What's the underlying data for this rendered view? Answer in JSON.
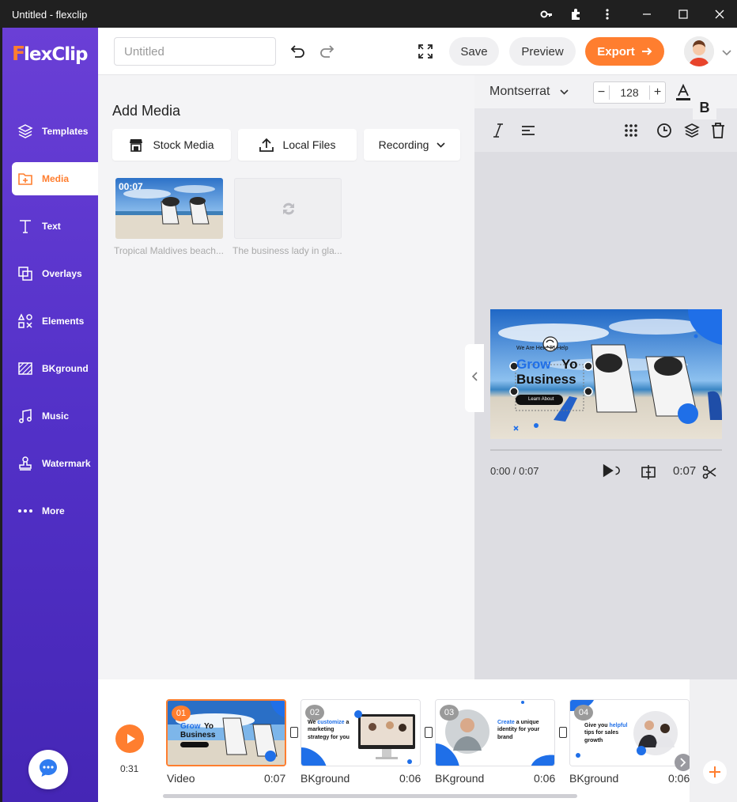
{
  "window": {
    "title": "Untitled - flexclip"
  },
  "logo": {
    "text": "FlexClip"
  },
  "sidebar": {
    "items": [
      {
        "label": "Templates",
        "icon": "layers-icon"
      },
      {
        "label": "Media",
        "icon": "media-folder-icon"
      },
      {
        "label": "Text",
        "icon": "text-icon"
      },
      {
        "label": "Overlays",
        "icon": "overlays-icon"
      },
      {
        "label": "Elements",
        "icon": "elements-icon"
      },
      {
        "label": "BKground",
        "icon": "background-icon"
      },
      {
        "label": "Music",
        "icon": "music-icon"
      },
      {
        "label": "Watermark",
        "icon": "watermark-icon"
      },
      {
        "label": "More",
        "icon": "more-icon"
      }
    ],
    "active": "Media"
  },
  "header": {
    "title_placeholder": "Untitled",
    "save_label": "Save",
    "preview_label": "Preview",
    "export_label": "Export"
  },
  "media_panel": {
    "heading": "Add Media",
    "stock_label": "Stock Media",
    "local_label": "Local Files",
    "recording_label": "Recording",
    "items": [
      {
        "caption": "Tropical Maldives beach...",
        "duration": "00:07"
      },
      {
        "caption": "The business lady in gla..."
      }
    ]
  },
  "text_toolbar": {
    "font": "Montserrat",
    "size": "128",
    "bold_label": "B"
  },
  "preview": {
    "small_text": "We Are Here To Help",
    "headline_1": "Grow",
    "headline_2": "Yo",
    "headline_3": "Business",
    "cta": "Learn About",
    "time_current": "0:00 / 0:07",
    "duration": "0:07"
  },
  "timeline": {
    "total": "0:31",
    "clips": [
      {
        "num": "01",
        "label": "Video",
        "duration": "0:07"
      },
      {
        "num": "02",
        "label": "BKground",
        "duration": "0:06",
        "text_pre": "We ",
        "text_hl": "customize",
        "text_post": " a marketing strategy for you"
      },
      {
        "num": "03",
        "label": "BKground",
        "duration": "0:06",
        "text_hl": "Create",
        "text_post": " a unique identity for your brand"
      },
      {
        "num": "04",
        "label": "BKground",
        "duration": "0:06",
        "text_pre": "Give you ",
        "text_hl": "helpful",
        "text_post": " tips for sales growth"
      }
    ]
  },
  "colors": {
    "accent": "#ff7e2f",
    "brand": "#5a36cf",
    "highlight_blue": "#1f6fe8"
  }
}
